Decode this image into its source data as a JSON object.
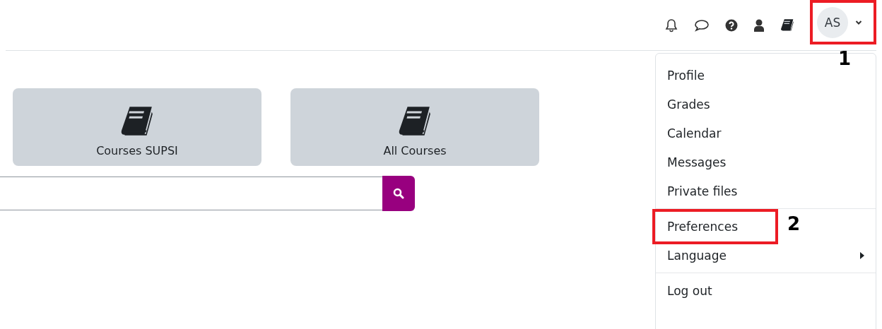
{
  "header": {
    "icons": [
      {
        "kind": "bell"
      },
      {
        "kind": "chat"
      },
      {
        "kind": "help"
      },
      {
        "kind": "user"
      },
      {
        "kind": "book"
      }
    ],
    "user_menu": {
      "initials": "AS",
      "highlighted": true,
      "annotation": "1"
    }
  },
  "cards": [
    {
      "label": "Courses SUPSI"
    },
    {
      "label": "All Courses"
    }
  ],
  "menu": {
    "groups": [
      [
        {
          "label": "Profile",
          "highlighted": false,
          "submenu": false
        },
        {
          "label": "Grades",
          "highlighted": false,
          "submenu": false
        },
        {
          "label": "Calendar",
          "highlighted": false,
          "submenu": false
        },
        {
          "label": "Messages",
          "highlighted": false,
          "submenu": false
        },
        {
          "label": "Private files",
          "highlighted": false,
          "submenu": false
        }
      ],
      [
        {
          "label": "Preferences",
          "highlighted": true,
          "submenu": false,
          "annotation": "2"
        },
        {
          "label": "Language",
          "highlighted": false,
          "submenu": true
        }
      ],
      [
        {
          "label": "Log out",
          "highlighted": false,
          "submenu": false
        }
      ]
    ]
  }
}
